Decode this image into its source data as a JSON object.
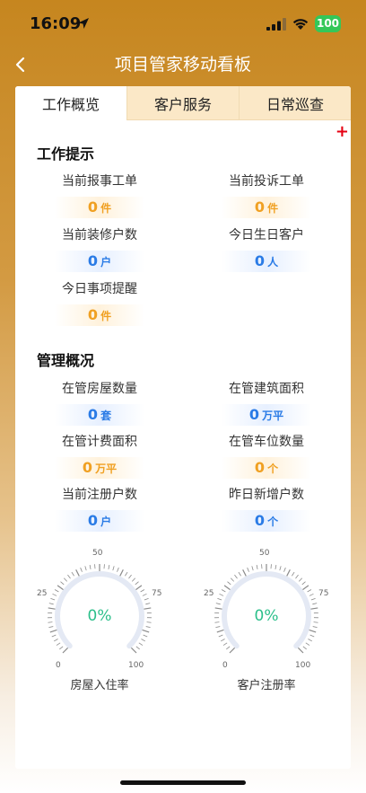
{
  "status_bar": {
    "time": "16:09",
    "battery": "100"
  },
  "nav": {
    "title": "项目管家移动看板"
  },
  "tabs": [
    {
      "label": "工作概览",
      "active": true
    },
    {
      "label": "客户服务",
      "active": false
    },
    {
      "label": "日常巡查",
      "active": false
    }
  ],
  "add_symbol": "+",
  "work_tips": {
    "title": "工作提示",
    "items": [
      {
        "label": "当前报事工单",
        "value": "0",
        "unit": "件",
        "color": "orange"
      },
      {
        "label": "当前投诉工单",
        "value": "0",
        "unit": "件",
        "color": "orange"
      },
      {
        "label": "当前装修户数",
        "value": "0",
        "unit": "户",
        "color": "blue"
      },
      {
        "label": "今日生日客户",
        "value": "0",
        "unit": "人",
        "color": "blue"
      },
      {
        "label": "今日事项提醒",
        "value": "0",
        "unit": "件",
        "color": "orange"
      }
    ]
  },
  "management": {
    "title": "管理概况",
    "items": [
      {
        "label": "在管房屋数量",
        "value": "0",
        "unit": "套",
        "color": "blue"
      },
      {
        "label": "在管建筑面积",
        "value": "0",
        "unit": "万平",
        "color": "blue"
      },
      {
        "label": "在管计费面积",
        "value": "0",
        "unit": "万平",
        "color": "orange"
      },
      {
        "label": "在管车位数量",
        "value": "0",
        "unit": "个",
        "color": "orange"
      },
      {
        "label": "当前注册户数",
        "value": "0",
        "unit": "户",
        "color": "blue"
      },
      {
        "label": "昨日新增户数",
        "value": "0",
        "unit": "个",
        "color": "blue"
      }
    ]
  },
  "gauges": [
    {
      "label": "房屋入住率",
      "value": "0%",
      "percent": 0,
      "ticks": [
        "0",
        "25",
        "50",
        "75",
        "100"
      ]
    },
    {
      "label": "客户注册率",
      "value": "0%",
      "percent": 0,
      "ticks": [
        "0",
        "25",
        "50",
        "75",
        "100"
      ]
    }
  ],
  "colors": {
    "orange": "#f0a022",
    "blue": "#2a7be6",
    "gauge_value": "#2bbf8a",
    "brand": "#c6861f"
  }
}
